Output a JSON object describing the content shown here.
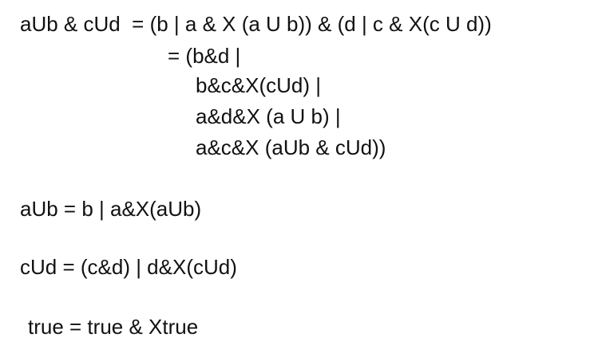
{
  "equations": {
    "line1": "aUb & cUd  = (b | a & X (a U b)) & (d | c & X(c U d))",
    "line2": "= (b&d |",
    "line3": "b&c&X(cUd) |",
    "line4": "a&d&X (a U b) |",
    "line5": "a&c&X (aUb & cUd))",
    "line6": "aUb = b | a&X(aUb)",
    "line7": "cUd = (c&d) | d&X(cUd)",
    "line8": "true = true & Xtrue"
  }
}
